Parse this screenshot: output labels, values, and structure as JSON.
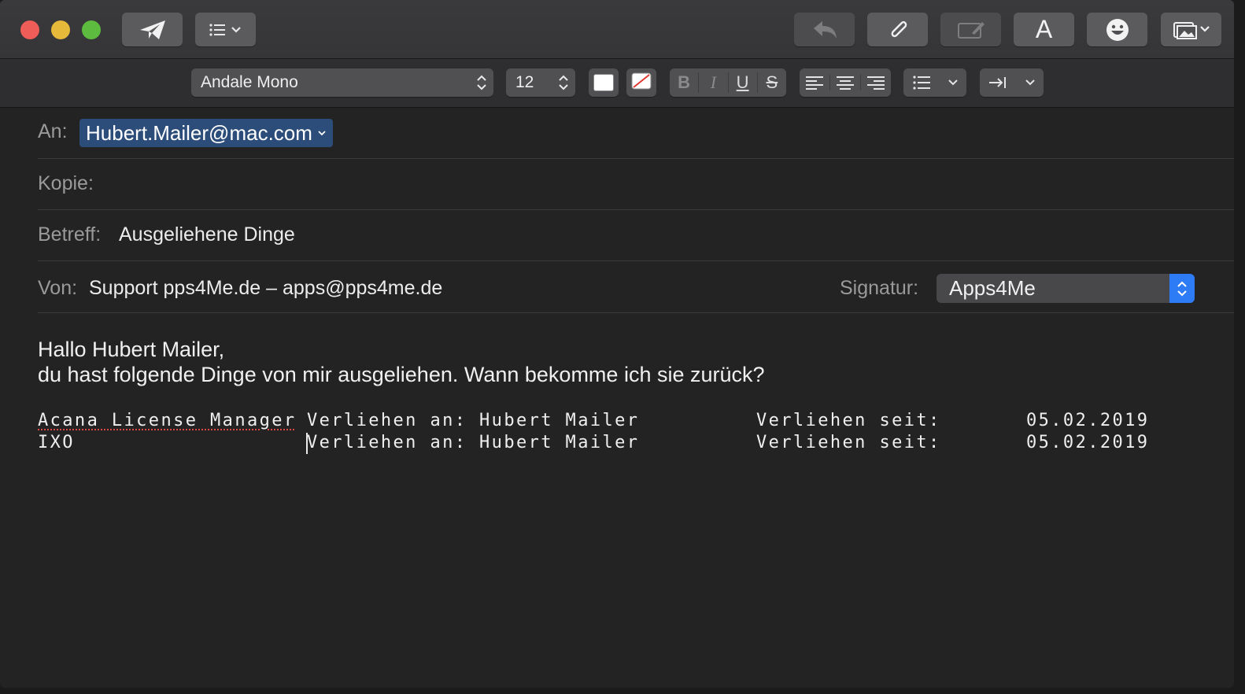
{
  "window": {
    "traffic_lights": [
      "close",
      "minimize",
      "zoom"
    ]
  },
  "toolbar": {
    "send_icon": "paper-plane-icon",
    "header_icon": "list-icon",
    "reply_icon": "reply-arrow-icon",
    "attach_icon": "paperclip-icon",
    "markup_icon": "markup-icon",
    "font_label": "A",
    "emoji_icon": "smiley-icon",
    "photo_icon": "photo-browser-icon"
  },
  "formatbar": {
    "font_family": "Andale Mono",
    "font_size": "12",
    "bold": "B",
    "italic": "I",
    "underline": "U",
    "strike": "S",
    "text_color": "#ffffff"
  },
  "header": {
    "to_label": "An:",
    "to_value": "Hubert.Mailer@mac.com",
    "cc_label": "Kopie:",
    "subject_label": "Betreff:",
    "subject_value": "Ausgeliehene Dinge",
    "from_label": "Von:",
    "from_value": "Support pps4Me.de – apps@pps4me.de",
    "signature_label": "Signatur:",
    "signature_value": "Apps4Me"
  },
  "body": {
    "greeting": "Hallo Hubert Mailer,",
    "line2": "du hast folgende Dinge von mir ausgeliehen. Wann bekomme ich sie zurück?",
    "rows": [
      {
        "item": "Acana License Manager",
        "lent": "Verliehen an: Hubert Mailer",
        "since_label": "Verliehen seit:",
        "date": "05.02.2019"
      },
      {
        "item": "IXO",
        "lent": "Verliehen an: Hubert Mailer",
        "since_label": "Verliehen seit:",
        "date": "05.02.2019"
      }
    ]
  },
  "colors": {
    "accent": "#2e7bf6",
    "token": "#2c4c79",
    "close": "#ee5d57",
    "minimize": "#e6b93b",
    "zoom": "#5dbc3f"
  }
}
